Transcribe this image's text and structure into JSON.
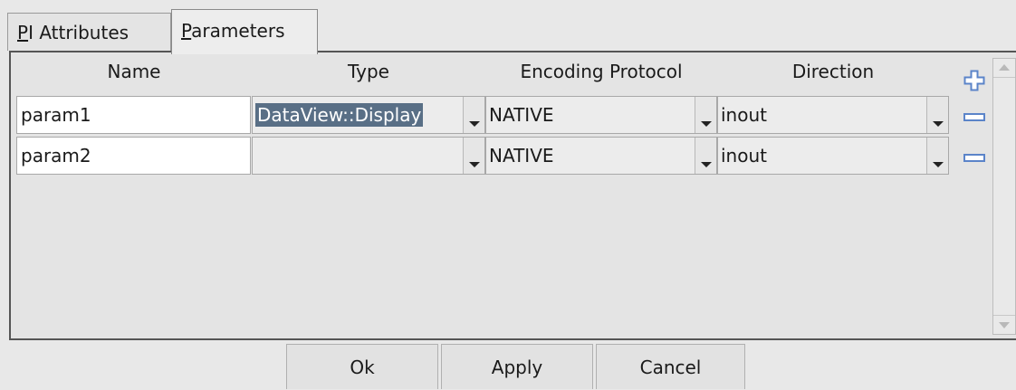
{
  "tabs": [
    {
      "mnemonic": "P",
      "rest": "I Attributes",
      "active": false
    },
    {
      "mnemonic": "P",
      "rest": "arameters",
      "active": true
    }
  ],
  "table": {
    "headers": [
      "Name",
      "Type",
      "Encoding Protocol",
      "Direction"
    ],
    "rows": [
      {
        "name": "param1",
        "type": "DataView::Display",
        "encoding": "NATIVE",
        "direction": "inout",
        "type_selected": true
      },
      {
        "name": "param2",
        "type": "",
        "encoding": "NATIVE",
        "direction": "inout",
        "type_selected": false
      }
    ]
  },
  "icons": {
    "add": "plus-icon",
    "remove": "minus-icon",
    "combo": "chevron-down-icon",
    "scroll_up": "arrow-up-icon",
    "scroll_down": "arrow-down-icon"
  },
  "colors": {
    "accent": "#5b84c9",
    "selection": "#596f86"
  },
  "buttons": {
    "ok": "Ok",
    "apply": "Apply",
    "cancel": "Cancel"
  }
}
